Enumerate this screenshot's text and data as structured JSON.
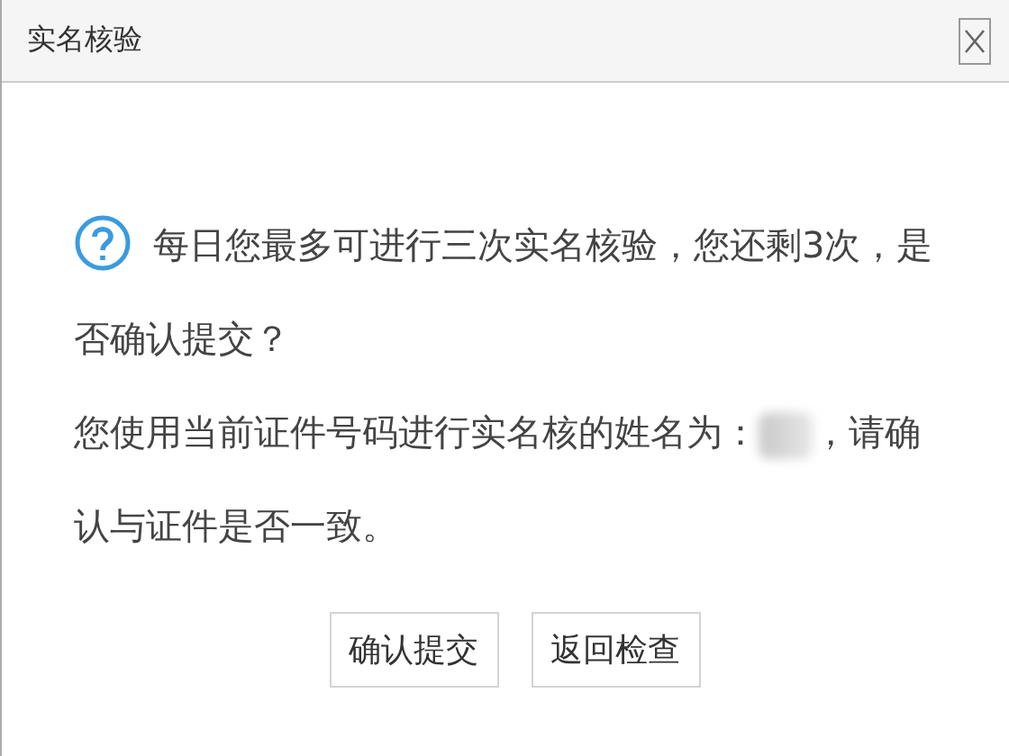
{
  "window": {
    "title": "实名核验"
  },
  "message": {
    "question_lines": [
      "每日您最多可进行三次实名核验，您还剩3次，是",
      "否确认提交？"
    ],
    "name_prefix": "您使用当前证件号码进行实名核的姓名为：",
    "name_redacted": true,
    "name_suffix": "，请确",
    "name_suffix_continued": "认与证件是否一致。"
  },
  "buttons": [
    "确认提交",
    "返回检查"
  ]
}
